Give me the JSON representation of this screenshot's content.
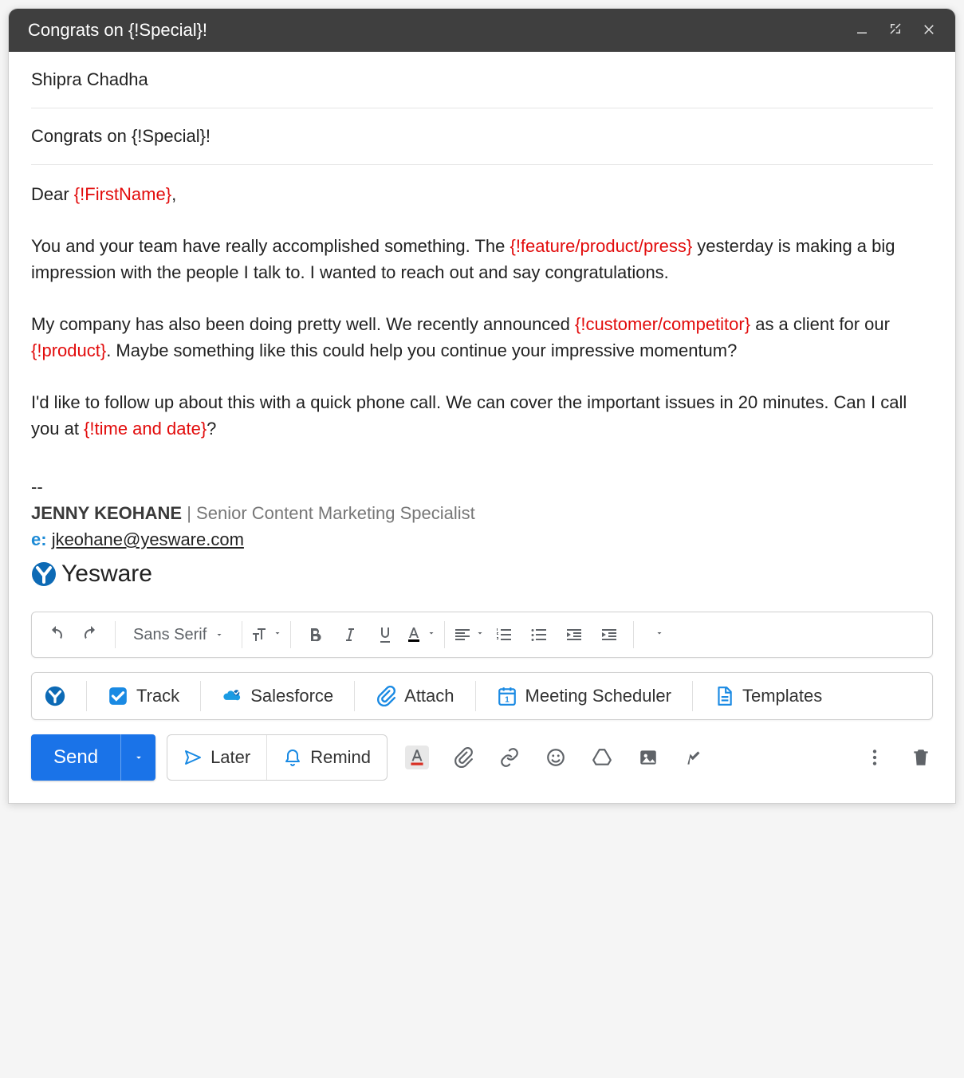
{
  "title": "Congrats on {!Special}!",
  "to": "Shipra Chadha",
  "subject": "Congrats on {!Special}!",
  "body": {
    "greeting_prefix": "Dear ",
    "greeting_ph": "{!FirstName}",
    "greeting_suffix": ",",
    "p1_a": "You and your team have really accomplished something. The ",
    "p1_ph": "{!feature/product/press}",
    "p1_b": " yesterday is making a big impression with the people I talk to. I wanted to reach out and say congratulations.",
    "p2_a": "My company has also been doing pretty well. We recently announced ",
    "p2_ph1": "{!customer/competitor}",
    "p2_b": " as a client for our ",
    "p2_ph2": "{!product}",
    "p2_c": ". Maybe something like this could help you continue your impressive momentum?",
    "p3_a": "I'd like to follow up about this with a quick phone call. We can cover the important issues in 20 minutes. Can I call you at ",
    "p3_ph": "{!time and date}",
    "p3_b": "?"
  },
  "signature": {
    "sep": "--",
    "name": "JENNY KEOHANE",
    "divider": " | ",
    "title": "Senior Content Marketing Specialist",
    "email_label": "e: ",
    "email": "jkeohane@yesware.com",
    "brand": "Yesware"
  },
  "format_toolbar": {
    "font": "Sans Serif"
  },
  "yesware_toolbar": {
    "track": "Track",
    "salesforce": "Salesforce",
    "attach": "Attach",
    "meeting": "Meeting Scheduler",
    "templates": "Templates"
  },
  "actions": {
    "send": "Send",
    "later": "Later",
    "remind": "Remind"
  }
}
